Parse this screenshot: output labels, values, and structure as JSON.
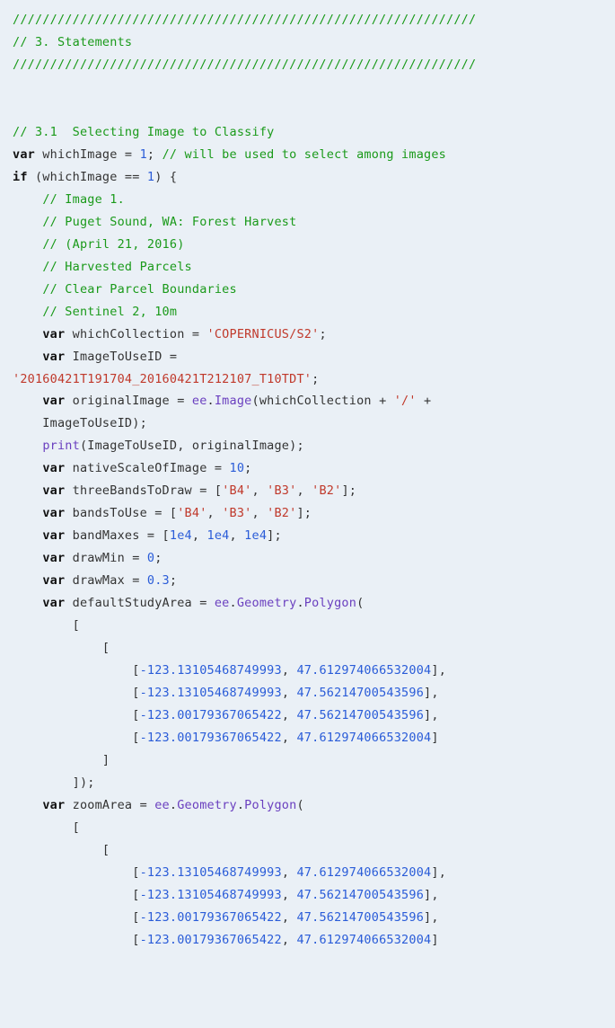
{
  "code": {
    "tokens": [
      {
        "c": "cm",
        "t": "//////////////////////////////////////////////////////////////"
      },
      {
        "br": 1
      },
      {
        "c": "cm",
        "t": "// 3. Statements"
      },
      {
        "br": 1
      },
      {
        "c": "cm",
        "t": "//////////////////////////////////////////////////////////////"
      },
      {
        "br": 1
      },
      {
        "br": 1
      },
      {
        "br": 1
      },
      {
        "c": "cm",
        "t": "// 3.1  Selecting Image to Classify"
      },
      {
        "br": 1
      },
      {
        "c": "kw",
        "t": "var"
      },
      {
        "c": "nm",
        "t": " whichImage = "
      },
      {
        "c": "nu",
        "t": "1"
      },
      {
        "c": "nm",
        "t": "; "
      },
      {
        "c": "cm",
        "t": "// will be used to select among images"
      },
      {
        "br": 1
      },
      {
        "c": "kw",
        "t": "if"
      },
      {
        "c": "nm",
        "t": " (whichImage == "
      },
      {
        "c": "nu",
        "t": "1"
      },
      {
        "c": "nm",
        "t": ") {"
      },
      {
        "br": 1
      },
      {
        "c": "nm",
        "t": "    "
      },
      {
        "c": "cm",
        "t": "// Image 1."
      },
      {
        "br": 1
      },
      {
        "c": "nm",
        "t": "    "
      },
      {
        "c": "cm",
        "t": "// Puget Sound, WA: Forest Harvest"
      },
      {
        "br": 1
      },
      {
        "c": "nm",
        "t": "    "
      },
      {
        "c": "cm",
        "t": "// (April 21, 2016)"
      },
      {
        "br": 1
      },
      {
        "c": "nm",
        "t": "    "
      },
      {
        "c": "cm",
        "t": "// Harvested Parcels"
      },
      {
        "br": 1
      },
      {
        "c": "nm",
        "t": "    "
      },
      {
        "c": "cm",
        "t": "// Clear Parcel Boundaries"
      },
      {
        "br": 1
      },
      {
        "c": "nm",
        "t": "    "
      },
      {
        "c": "cm",
        "t": "// Sentinel 2, 10m"
      },
      {
        "br": 1
      },
      {
        "c": "nm",
        "t": "    "
      },
      {
        "c": "kw",
        "t": "var"
      },
      {
        "c": "nm",
        "t": " whichCollection = "
      },
      {
        "c": "st",
        "t": "'COPERNICUS/S2'"
      },
      {
        "c": "nm",
        "t": ";"
      },
      {
        "br": 1
      },
      {
        "c": "nm",
        "t": "    "
      },
      {
        "c": "kw",
        "t": "var"
      },
      {
        "c": "nm",
        "t": " ImageToUseID ="
      },
      {
        "br": 1
      },
      {
        "c": "st",
        "t": "'20160421T191704_20160421T212107_T10TDT'"
      },
      {
        "c": "nm",
        "t": ";"
      },
      {
        "br": 1
      },
      {
        "c": "nm",
        "t": "    "
      },
      {
        "c": "kw",
        "t": "var"
      },
      {
        "c": "nm",
        "t": " originalImage = "
      },
      {
        "c": "ee",
        "t": "ee"
      },
      {
        "c": "nm",
        "t": "."
      },
      {
        "c": "ee",
        "t": "Image"
      },
      {
        "c": "nm",
        "t": "(whichCollection + "
      },
      {
        "c": "st",
        "t": "'/'"
      },
      {
        "c": "nm",
        "t": " +"
      },
      {
        "br": 1
      },
      {
        "c": "nm",
        "t": "    ImageToUseID);"
      },
      {
        "br": 1
      },
      {
        "c": "nm",
        "t": "    "
      },
      {
        "c": "ee",
        "t": "print"
      },
      {
        "c": "nm",
        "t": "(ImageToUseID, originalImage);"
      },
      {
        "br": 1
      },
      {
        "c": "nm",
        "t": "    "
      },
      {
        "c": "kw",
        "t": "var"
      },
      {
        "c": "nm",
        "t": " nativeScaleOfImage = "
      },
      {
        "c": "nu",
        "t": "10"
      },
      {
        "c": "nm",
        "t": ";"
      },
      {
        "br": 1
      },
      {
        "c": "nm",
        "t": "    "
      },
      {
        "c": "kw",
        "t": "var"
      },
      {
        "c": "nm",
        "t": " threeBandsToDraw = ["
      },
      {
        "c": "st",
        "t": "'B4'"
      },
      {
        "c": "nm",
        "t": ", "
      },
      {
        "c": "st",
        "t": "'B3'"
      },
      {
        "c": "nm",
        "t": ", "
      },
      {
        "c": "st",
        "t": "'B2'"
      },
      {
        "c": "nm",
        "t": "];"
      },
      {
        "br": 1
      },
      {
        "c": "nm",
        "t": "    "
      },
      {
        "c": "kw",
        "t": "var"
      },
      {
        "c": "nm",
        "t": " bandsToUse = ["
      },
      {
        "c": "st",
        "t": "'B4'"
      },
      {
        "c": "nm",
        "t": ", "
      },
      {
        "c": "st",
        "t": "'B3'"
      },
      {
        "c": "nm",
        "t": ", "
      },
      {
        "c": "st",
        "t": "'B2'"
      },
      {
        "c": "nm",
        "t": "];"
      },
      {
        "br": 1
      },
      {
        "c": "nm",
        "t": "    "
      },
      {
        "c": "kw",
        "t": "var"
      },
      {
        "c": "nm",
        "t": " bandMaxes = ["
      },
      {
        "c": "nu",
        "t": "1e4"
      },
      {
        "c": "nm",
        "t": ", "
      },
      {
        "c": "nu",
        "t": "1e4"
      },
      {
        "c": "nm",
        "t": ", "
      },
      {
        "c": "nu",
        "t": "1e4"
      },
      {
        "c": "nm",
        "t": "];"
      },
      {
        "br": 1
      },
      {
        "c": "nm",
        "t": "    "
      },
      {
        "c": "kw",
        "t": "var"
      },
      {
        "c": "nm",
        "t": " drawMin = "
      },
      {
        "c": "nu",
        "t": "0"
      },
      {
        "c": "nm",
        "t": ";"
      },
      {
        "br": 1
      },
      {
        "c": "nm",
        "t": "    "
      },
      {
        "c": "kw",
        "t": "var"
      },
      {
        "c": "nm",
        "t": " drawMax = "
      },
      {
        "c": "nu",
        "t": "0.3"
      },
      {
        "c": "nm",
        "t": ";"
      },
      {
        "br": 1
      },
      {
        "c": "nm",
        "t": "    "
      },
      {
        "c": "kw",
        "t": "var"
      },
      {
        "c": "nm",
        "t": " defaultStudyArea = "
      },
      {
        "c": "ee",
        "t": "ee"
      },
      {
        "c": "nm",
        "t": "."
      },
      {
        "c": "ee",
        "t": "Geometry"
      },
      {
        "c": "nm",
        "t": "."
      },
      {
        "c": "ee",
        "t": "Polygon"
      },
      {
        "c": "nm",
        "t": "("
      },
      {
        "br": 1
      },
      {
        "c": "nm",
        "t": "        ["
      },
      {
        "br": 1
      },
      {
        "c": "nm",
        "t": "            ["
      },
      {
        "br": 1
      },
      {
        "c": "nm",
        "t": "                ["
      },
      {
        "c": "nu",
        "t": "-123.13105468749993"
      },
      {
        "c": "nm",
        "t": ", "
      },
      {
        "c": "nu",
        "t": "47.612974066532004"
      },
      {
        "c": "nm",
        "t": "],"
      },
      {
        "br": 1
      },
      {
        "c": "nm",
        "t": "                ["
      },
      {
        "c": "nu",
        "t": "-123.13105468749993"
      },
      {
        "c": "nm",
        "t": ", "
      },
      {
        "c": "nu",
        "t": "47.56214700543596"
      },
      {
        "c": "nm",
        "t": "],"
      },
      {
        "br": 1
      },
      {
        "c": "nm",
        "t": "                ["
      },
      {
        "c": "nu",
        "t": "-123.00179367065422"
      },
      {
        "c": "nm",
        "t": ", "
      },
      {
        "c": "nu",
        "t": "47.56214700543596"
      },
      {
        "c": "nm",
        "t": "],"
      },
      {
        "br": 1
      },
      {
        "c": "nm",
        "t": "                ["
      },
      {
        "c": "nu",
        "t": "-123.00179367065422"
      },
      {
        "c": "nm",
        "t": ", "
      },
      {
        "c": "nu",
        "t": "47.612974066532004"
      },
      {
        "c": "nm",
        "t": "]"
      },
      {
        "br": 1
      },
      {
        "c": "nm",
        "t": "            ]"
      },
      {
        "br": 1
      },
      {
        "c": "nm",
        "t": "        ]);"
      },
      {
        "br": 1
      },
      {
        "c": "nm",
        "t": "    "
      },
      {
        "c": "kw",
        "t": "var"
      },
      {
        "c": "nm",
        "t": " zoomArea = "
      },
      {
        "c": "ee",
        "t": "ee"
      },
      {
        "c": "nm",
        "t": "."
      },
      {
        "c": "ee",
        "t": "Geometry"
      },
      {
        "c": "nm",
        "t": "."
      },
      {
        "c": "ee",
        "t": "Polygon"
      },
      {
        "c": "nm",
        "t": "("
      },
      {
        "br": 1
      },
      {
        "c": "nm",
        "t": "        ["
      },
      {
        "br": 1
      },
      {
        "c": "nm",
        "t": "            ["
      },
      {
        "br": 1
      },
      {
        "c": "nm",
        "t": "                ["
      },
      {
        "c": "nu",
        "t": "-123.13105468749993"
      },
      {
        "c": "nm",
        "t": ", "
      },
      {
        "c": "nu",
        "t": "47.612974066532004"
      },
      {
        "c": "nm",
        "t": "],"
      },
      {
        "br": 1
      },
      {
        "c": "nm",
        "t": "                ["
      },
      {
        "c": "nu",
        "t": "-123.13105468749993"
      },
      {
        "c": "nm",
        "t": ", "
      },
      {
        "c": "nu",
        "t": "47.56214700543596"
      },
      {
        "c": "nm",
        "t": "],"
      },
      {
        "br": 1
      },
      {
        "c": "nm",
        "t": "                ["
      },
      {
        "c": "nu",
        "t": "-123.00179367065422"
      },
      {
        "c": "nm",
        "t": ", "
      },
      {
        "c": "nu",
        "t": "47.56214700543596"
      },
      {
        "c": "nm",
        "t": "],"
      },
      {
        "br": 1
      },
      {
        "c": "nm",
        "t": "                ["
      },
      {
        "c": "nu",
        "t": "-123.00179367065422"
      },
      {
        "c": "nm",
        "t": ", "
      },
      {
        "c": "nu",
        "t": "47.612974066532004"
      },
      {
        "c": "nm",
        "t": "]"
      }
    ]
  }
}
